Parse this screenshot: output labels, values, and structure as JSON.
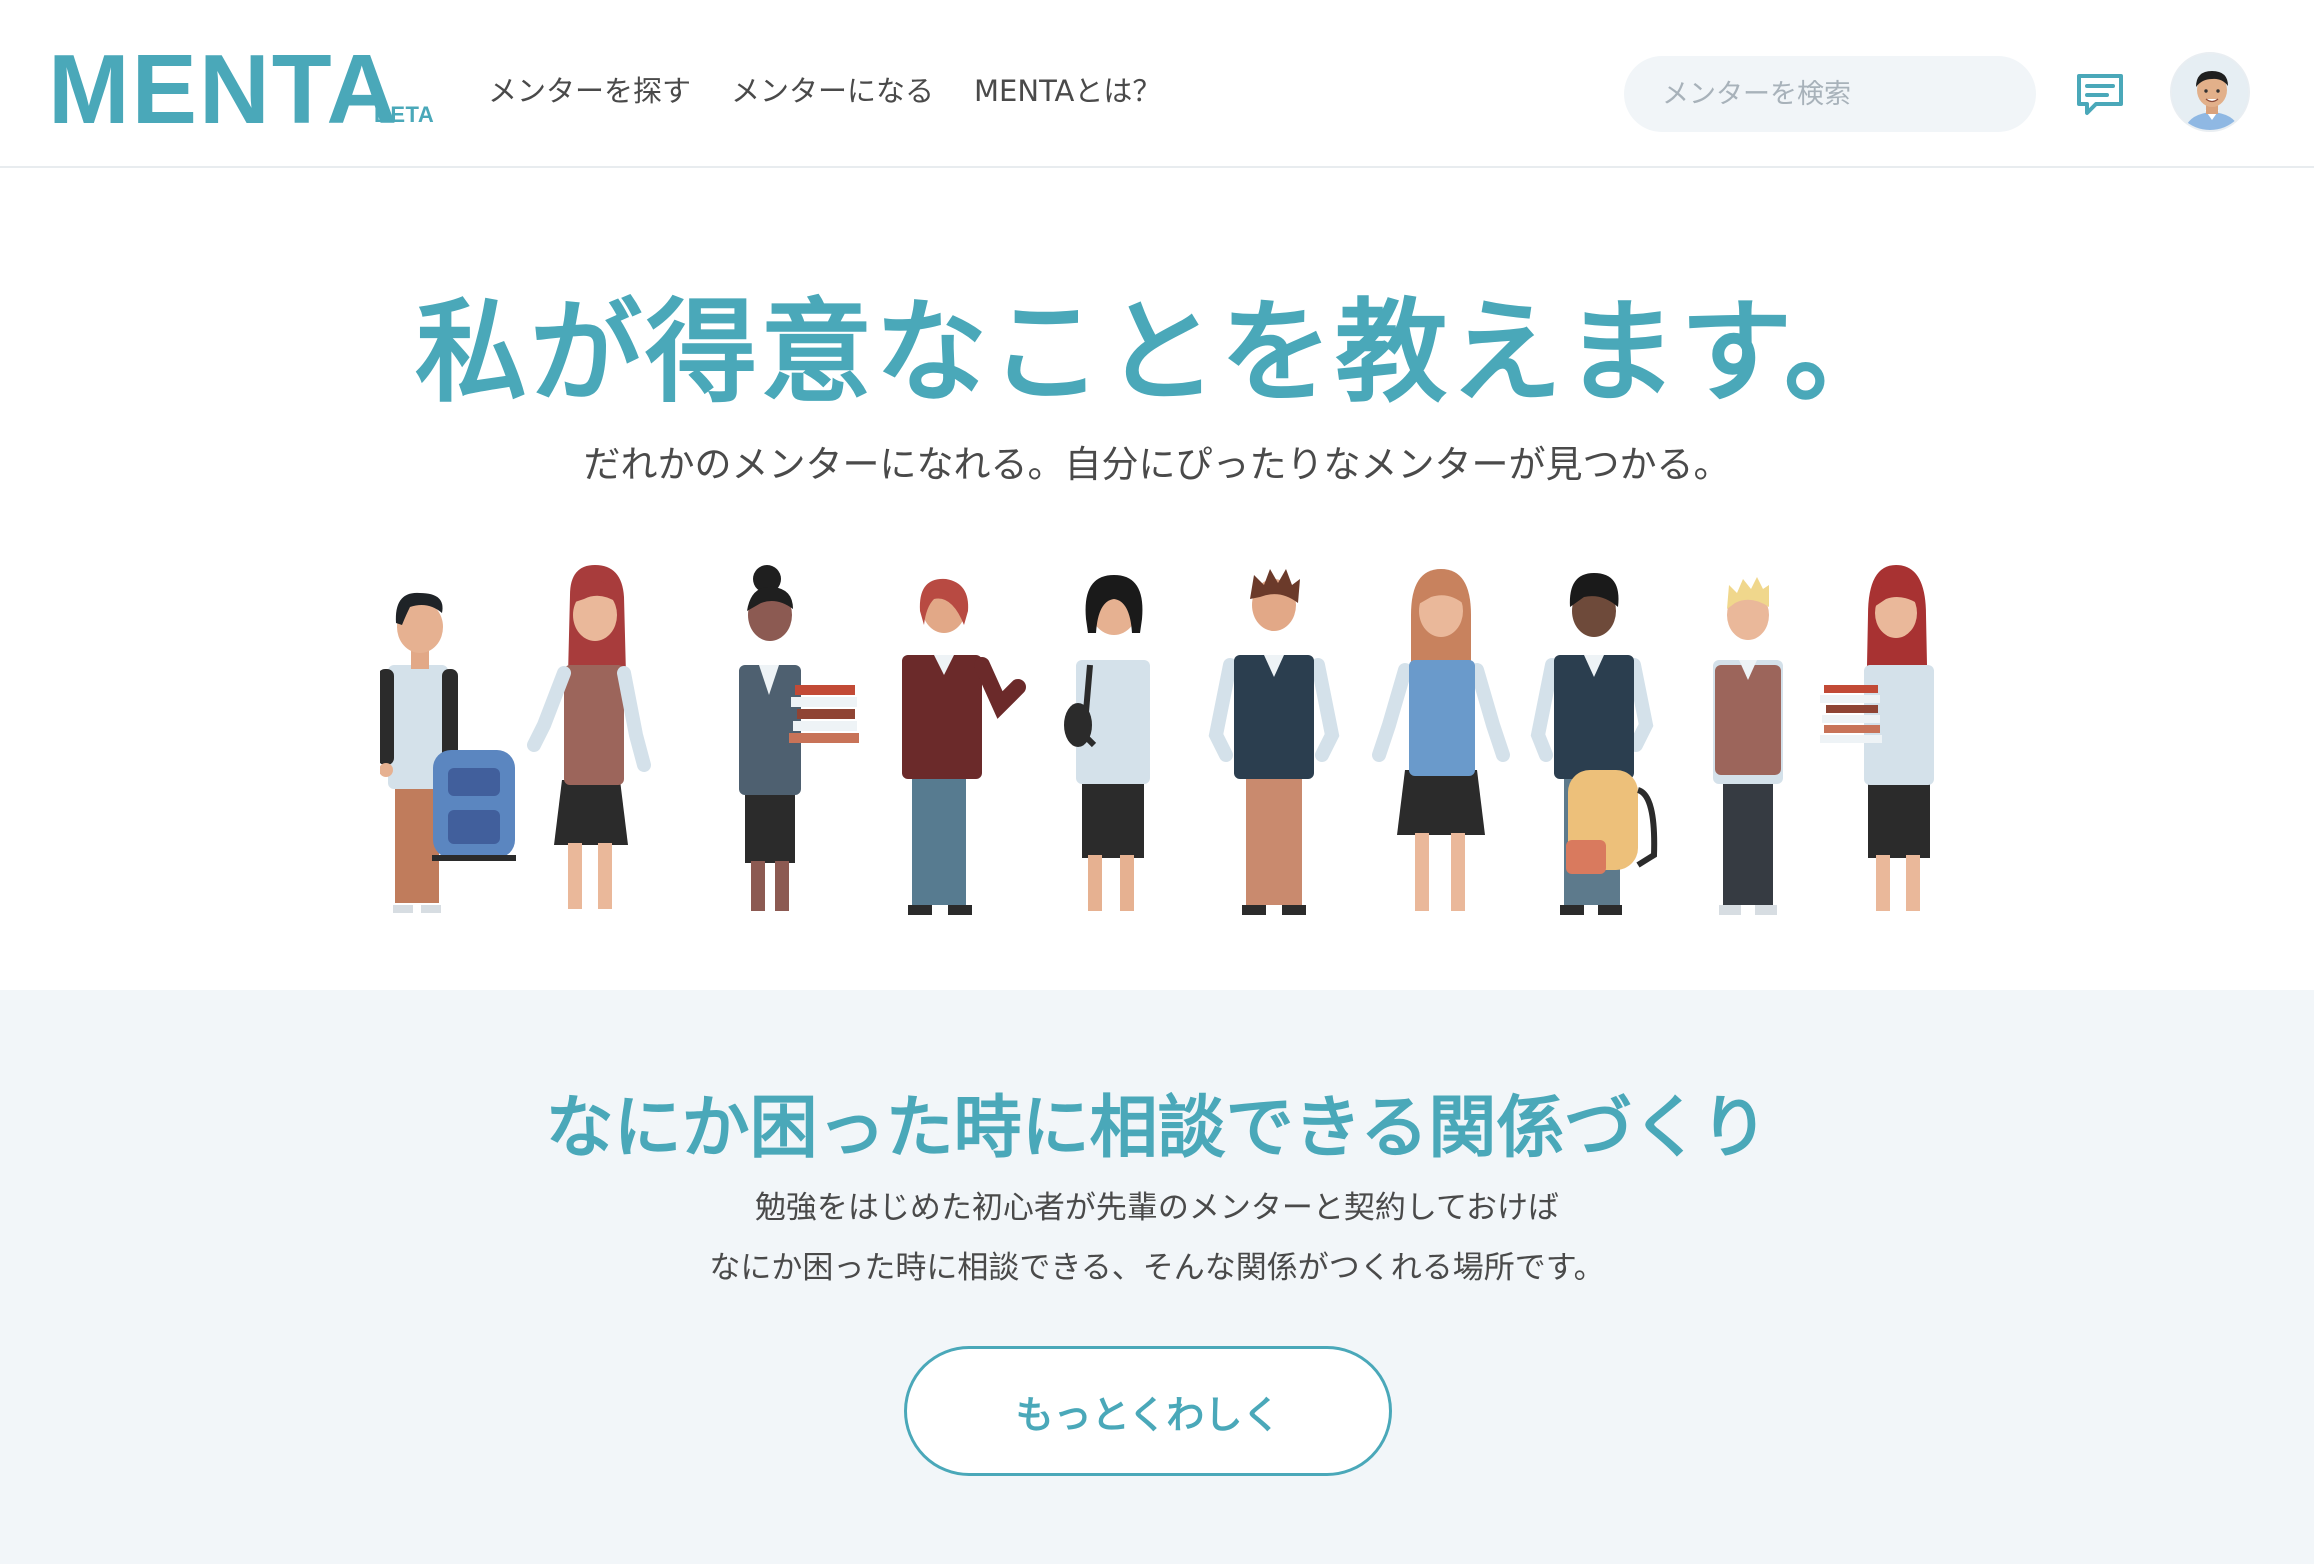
{
  "header": {
    "logo": "MENTA",
    "logo_badge": "BETA",
    "nav": [
      {
        "label": "メンターを探す"
      },
      {
        "label": "メンターになる"
      },
      {
        "label": "MENTAとは？"
      }
    ],
    "search": {
      "placeholder": "メンターを検索",
      "value": ""
    },
    "icons": {
      "messages": "chat-icon",
      "user": "avatar"
    }
  },
  "hero": {
    "title": "私が得意なことを教えます。",
    "subtitle": "だれかのメンターになれる。自分にぴったりなメンターが見つかる。"
  },
  "section2": {
    "title": "なにか困った時に相談できる関係づくり",
    "lines": [
      "勉強をはじめた初心者が先輩のメンターと契約しておけば",
      "なにか困った時に相談できる、そんな関係がつくれる場所です。"
    ],
    "button_label": "もっとくわしく"
  },
  "colors": {
    "brand": "#4aa8b9",
    "text": "#4a4a4a",
    "section_bg": "#f2f6f9",
    "search_bg": "#f1f5f8"
  }
}
